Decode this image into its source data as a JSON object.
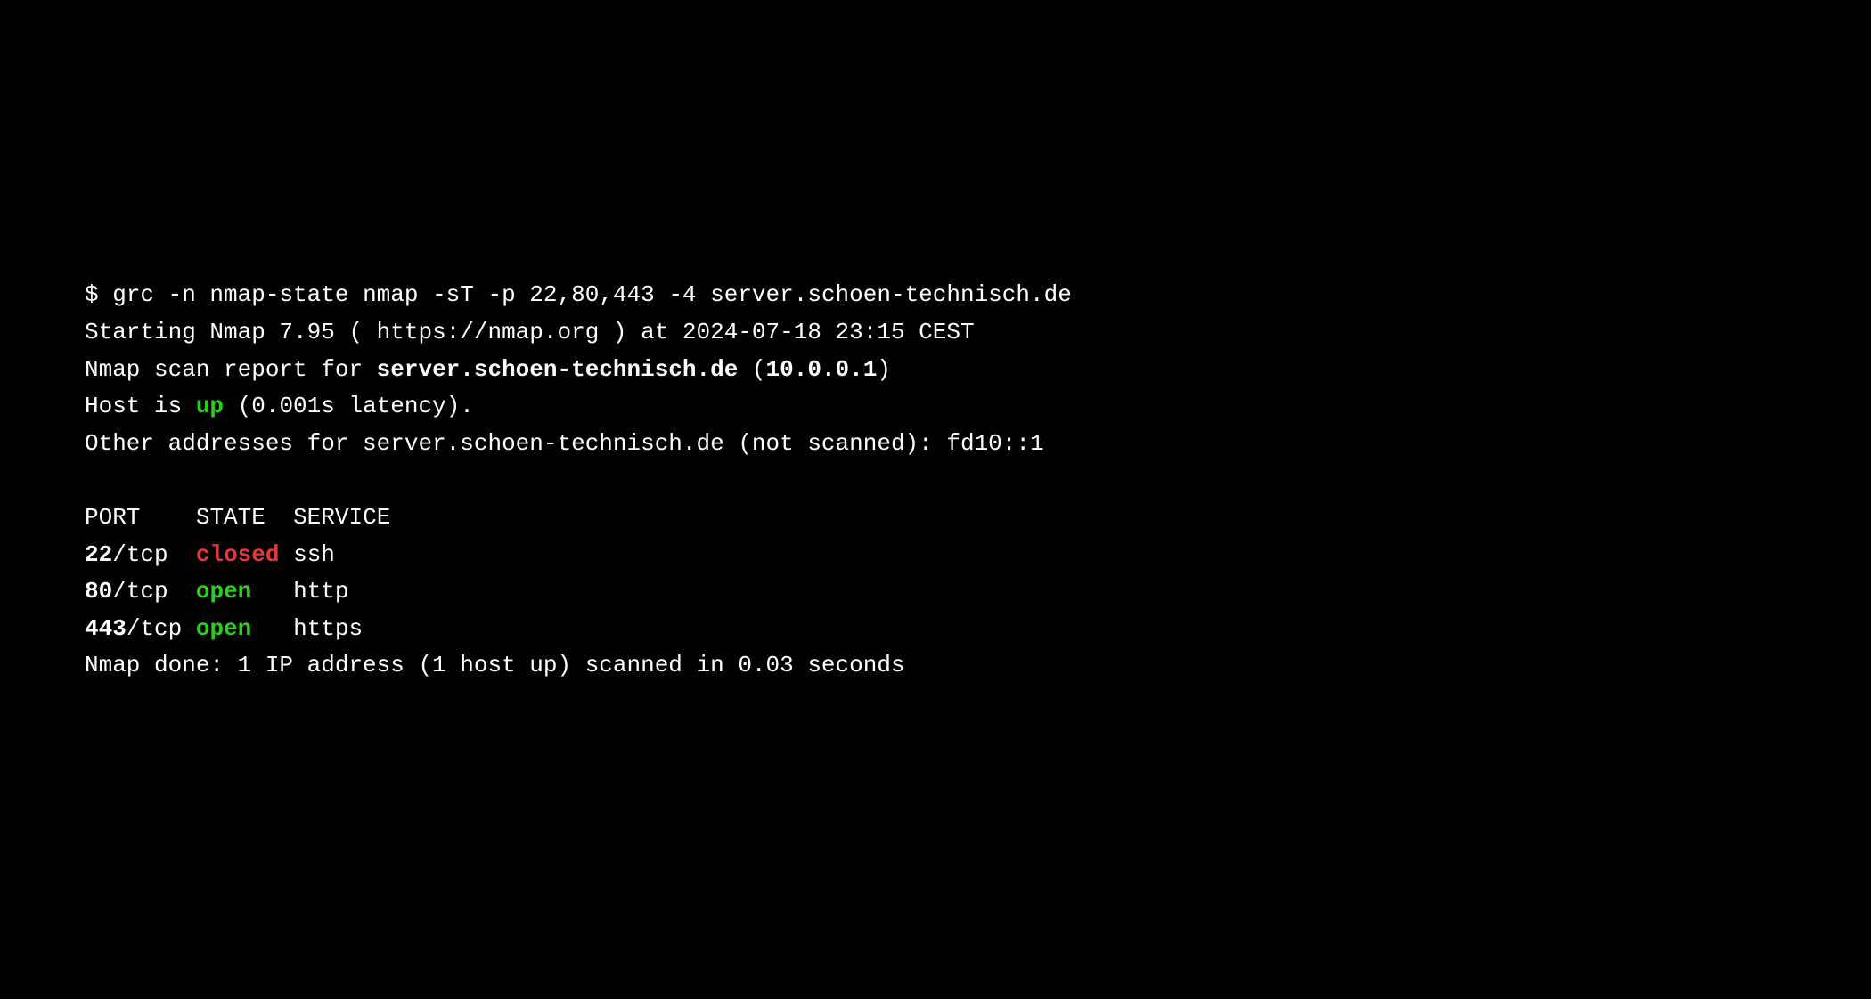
{
  "prompt": "$ ",
  "command": "grc -n nmap-state nmap -sT -p 22,80,443 -4 server.schoen-technisch.de",
  "starting": "Starting Nmap 7.95 ( https://nmap.org ) at 2024-07-18 23:15 CEST",
  "report_prefix": "Nmap scan report for ",
  "report_host": "server.schoen-technisch.de",
  "report_sep": " (",
  "report_ip": "10.0.0.1",
  "report_suffix": ")",
  "host_prefix": "Host is ",
  "host_state": "up",
  "host_latency": " (0.001s latency).",
  "other_addresses": "Other addresses for server.schoen-technisch.de (not scanned): fd10::1",
  "header_port": "PORT",
  "header_state": "STATE",
  "header_service": "SERVICE",
  "ports": [
    {
      "port": "22",
      "proto": "/tcp",
      "state": "closed",
      "state_class": "red-bold",
      "service": "ssh",
      "pad1": "  ",
      "pad2": " "
    },
    {
      "port": "80",
      "proto": "/tcp",
      "state": "open",
      "state_class": "green-bold",
      "service": "http",
      "pad1": "  ",
      "pad2": "   "
    },
    {
      "port": "443",
      "proto": "/tcp",
      "state": "open",
      "state_class": "green-bold",
      "service": "https",
      "pad1": " ",
      "pad2": "   "
    }
  ],
  "done": "Nmap done: 1 IP address (1 host up) scanned in 0.03 seconds"
}
